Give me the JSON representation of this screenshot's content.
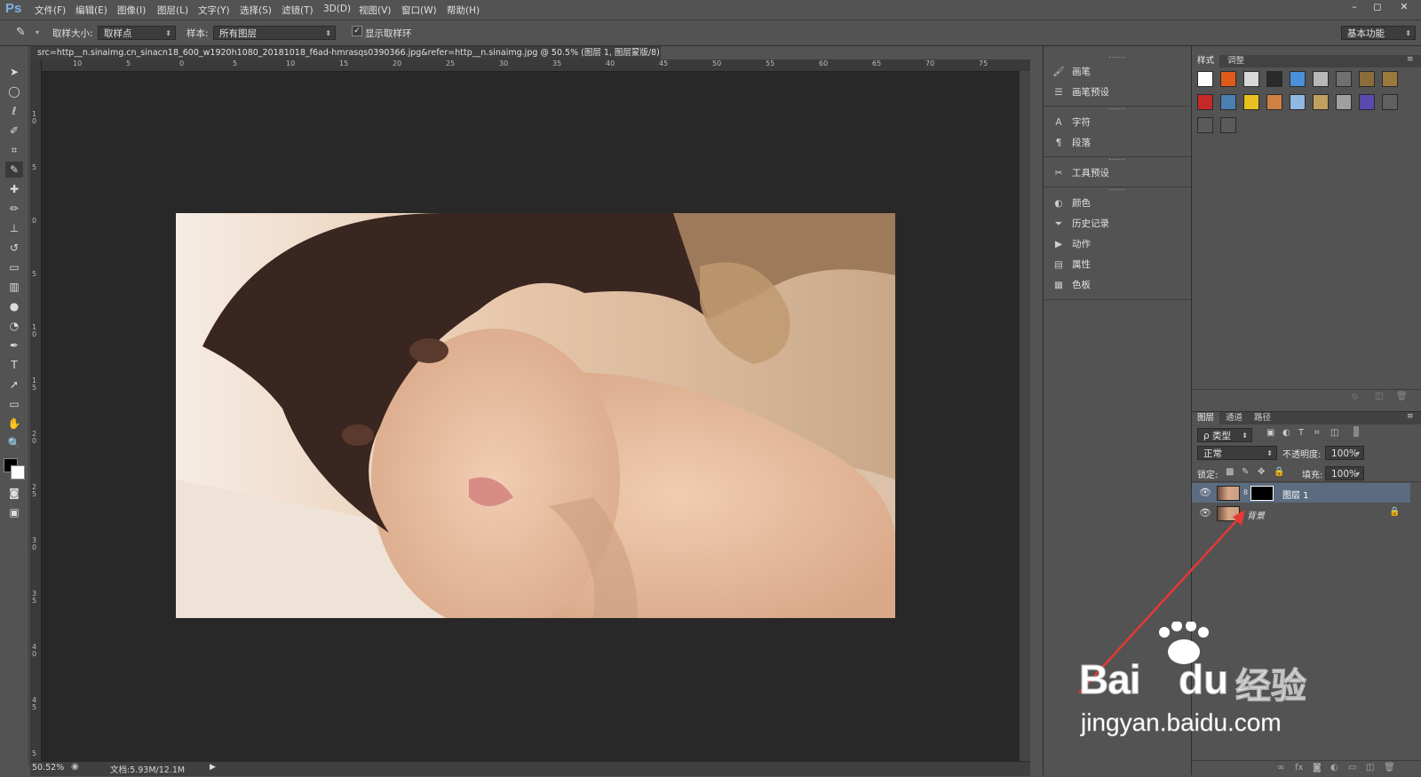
{
  "menubar": {
    "logo": "Ps",
    "items": [
      "文件(F)",
      "编辑(E)",
      "图像(I)",
      "图层(L)",
      "文字(Y)",
      "选择(S)",
      "滤镜(T)",
      "3D(D)",
      "视图(V)",
      "窗口(W)",
      "帮助(H)"
    ],
    "win_buttons": [
      "–",
      "◻",
      "✕"
    ]
  },
  "options": {
    "sample_size_label": "取样大小:",
    "sample_size_value": "取样点",
    "sample_label": "样本:",
    "sample_value": "所有图层",
    "show_ring_label": "显示取样环",
    "show_ring_checked": true,
    "workspace_value": "基本功能"
  },
  "document": {
    "tab_title": "src=http__n.sinaimg.cn_sinacn18_600_w1920h1080_20181018_f6ad-hmrasqs0390366.jpg&refer=http__n.sinaimg.jpg @ 50.5% (图层 1, 图层蒙版/8) *",
    "tab_close": "×",
    "ruler_top": [
      "10",
      "5",
      "0",
      "5",
      "10",
      "15",
      "20",
      "25",
      "30",
      "35",
      "40",
      "45",
      "50",
      "55",
      "60",
      "65",
      "70",
      "75"
    ],
    "ruler_left": [
      "1 0",
      "5",
      "0",
      "5",
      "1 0",
      "1 5",
      "2 0",
      "2 5",
      "3 0",
      "3 5",
      "4 0",
      "4 5",
      "5"
    ]
  },
  "status": {
    "zoom": "50.52%",
    "doc_size": "文档:5.93M/12.1M"
  },
  "midpanel": {
    "items": [
      {
        "icon": "brush-icon",
        "glyph": "🖌",
        "label": "画笔"
      },
      {
        "icon": "brush-preset-icon",
        "glyph": "☰",
        "label": "画笔预设"
      },
      {
        "icon": "character-icon",
        "glyph": "A",
        "label": "字符"
      },
      {
        "icon": "paragraph-icon",
        "glyph": "¶",
        "label": "段落"
      },
      {
        "icon": "tool-preset-icon",
        "glyph": "✂",
        "label": "工具预设"
      },
      {
        "icon": "color-icon",
        "glyph": "◐",
        "label": "颜色"
      },
      {
        "icon": "history-icon",
        "glyph": "⏷",
        "label": "历史记录"
      },
      {
        "icon": "actions-icon",
        "glyph": "▶",
        "label": "动作"
      },
      {
        "icon": "properties-icon",
        "glyph": "▤",
        "label": "属性"
      },
      {
        "icon": "swatches-icon",
        "glyph": "▦",
        "label": "色板"
      }
    ]
  },
  "styles_panel": {
    "tabs": [
      "样式",
      "调整"
    ],
    "swatches": [
      "#ffffff",
      "#e05a1a",
      "#d8d8d8",
      "#2a2a2a",
      "#4a90d9",
      "#b8b8b8",
      "#707070",
      "#8a6d3b",
      "#9a7a3c",
      "#c62828",
      "#4a7fb0",
      "#e8c020",
      "#d08040",
      "#90b8e0",
      "#c0a060",
      "#a0a0a0",
      "#5a4ab0",
      "#606060",
      "#5a5a5a",
      "#5a5a5a"
    ]
  },
  "layers_panel": {
    "tabs": [
      "图层",
      "通道",
      "路径"
    ],
    "filter_type": "ρ 类型",
    "blend_mode": "正常",
    "opacity_label": "不透明度:",
    "opacity_value": "100%",
    "lock_label": "锁定:",
    "fill_label": "填充:",
    "fill_value": "100%",
    "layers": [
      {
        "name": "图层 1",
        "selected": true,
        "has_mask": true
      },
      {
        "name": "背景",
        "selected": false,
        "locked": true
      }
    ]
  },
  "watermark": {
    "brand": "Bai",
    "brand2": "du",
    "cn": "经验",
    "url": "jingyan.baidu.com"
  }
}
